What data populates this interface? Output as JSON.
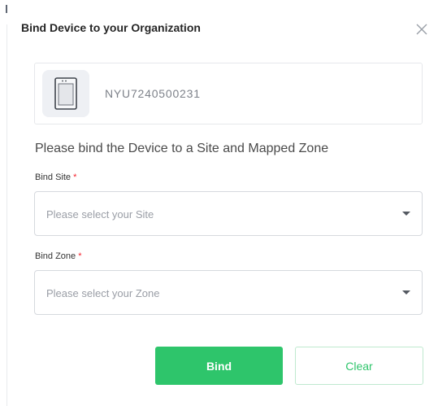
{
  "dialog": {
    "title": "Bind Device to your Organization",
    "close_icon": "close-icon"
  },
  "device": {
    "icon": "device-tablet-icon",
    "serial": "NYU7240500231"
  },
  "instruction": "Please bind the Device to a Site and Mapped Zone",
  "site_field": {
    "label": "Bind Site",
    "required_mark": "*",
    "placeholder": "Please select your Site",
    "caret_icon": "caret-down-icon"
  },
  "zone_field": {
    "label": "Bind Zone",
    "required_mark": "*",
    "placeholder": "Please select your Zone",
    "caret_icon": "caret-down-icon"
  },
  "actions": {
    "bind_label": "Bind",
    "clear_label": "Clear"
  },
  "colors": {
    "accent": "#2ec56b",
    "required": "#f5222d"
  }
}
